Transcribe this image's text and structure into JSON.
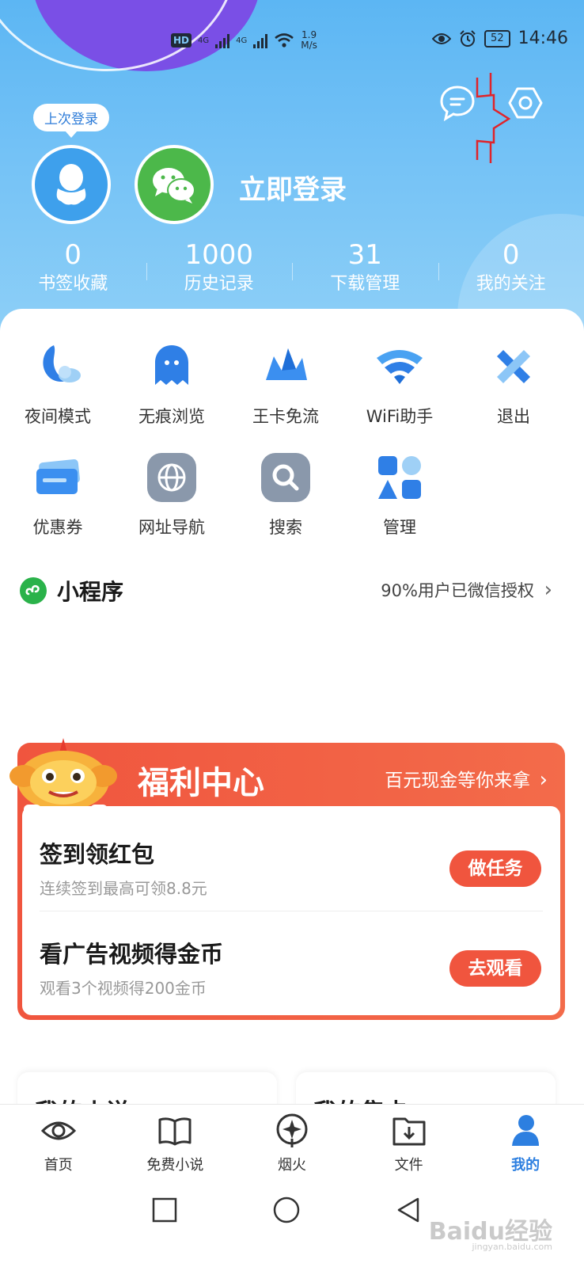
{
  "status_bar": {
    "hd": "HD",
    "net1": "4G",
    "net2": "4G",
    "speed_value": "1.9",
    "speed_unit": "M/s",
    "battery": "52",
    "time": "14:46"
  },
  "header": {
    "last_login_badge": "上次登录",
    "login_cta": "立即登录",
    "stats": [
      {
        "value": "0",
        "label": "书签收藏"
      },
      {
        "value": "1000",
        "label": "历史记录"
      },
      {
        "value": "31",
        "label": "下载管理"
      },
      {
        "value": "0",
        "label": "我的关注"
      }
    ]
  },
  "tools": [
    {
      "label": "夜间模式",
      "icon": "night-mode-icon"
    },
    {
      "label": "无痕浏览",
      "icon": "incognito-ghost-icon"
    },
    {
      "label": "王卡免流",
      "icon": "king-card-icon"
    },
    {
      "label": "WiFi助手",
      "icon": "wifi-icon"
    },
    {
      "label": "退出",
      "icon": "exit-icon"
    },
    {
      "label": "优惠券",
      "icon": "coupon-icon"
    },
    {
      "label": "网址导航",
      "icon": "globe-icon"
    },
    {
      "label": "搜索",
      "icon": "search-icon"
    },
    {
      "label": "管理",
      "icon": "manage-icon"
    }
  ],
  "mini_program": {
    "title": "小程序",
    "right_text": "90%用户已微信授权",
    "chevron": "›"
  },
  "welfare": {
    "title": "福利中心",
    "right_text": "百元现金等你来拿",
    "chevron": "›",
    "tasks": [
      {
        "title": "签到领红包",
        "subtitle": "连续签到最高可领8.8元",
        "button": "做任务"
      },
      {
        "title": "看广告视频得金币",
        "subtitle": "观看3个视频得200金币",
        "button": "去观看"
      }
    ]
  },
  "peek_cards": [
    {
      "title": "我的小说"
    },
    {
      "title": "我的集卡"
    }
  ],
  "bottom_nav": [
    {
      "label": "首页",
      "icon": "eye-icon"
    },
    {
      "label": "免费小说",
      "icon": "book-icon"
    },
    {
      "label": "烟火",
      "icon": "firework-icon"
    },
    {
      "label": "文件",
      "icon": "file-download-icon"
    },
    {
      "label": "我的",
      "icon": "profile-icon",
      "active": true
    }
  ],
  "watermark": {
    "text": "Baidu经验",
    "sub": "jingyan.baidu.com"
  },
  "colors": {
    "header_blue": "#5cb6f3",
    "accent_blue": "#2d7fe0",
    "welfare_red": "#f0553e",
    "wechat_green": "#4cb84a",
    "annotation_red": "#e0242a"
  }
}
